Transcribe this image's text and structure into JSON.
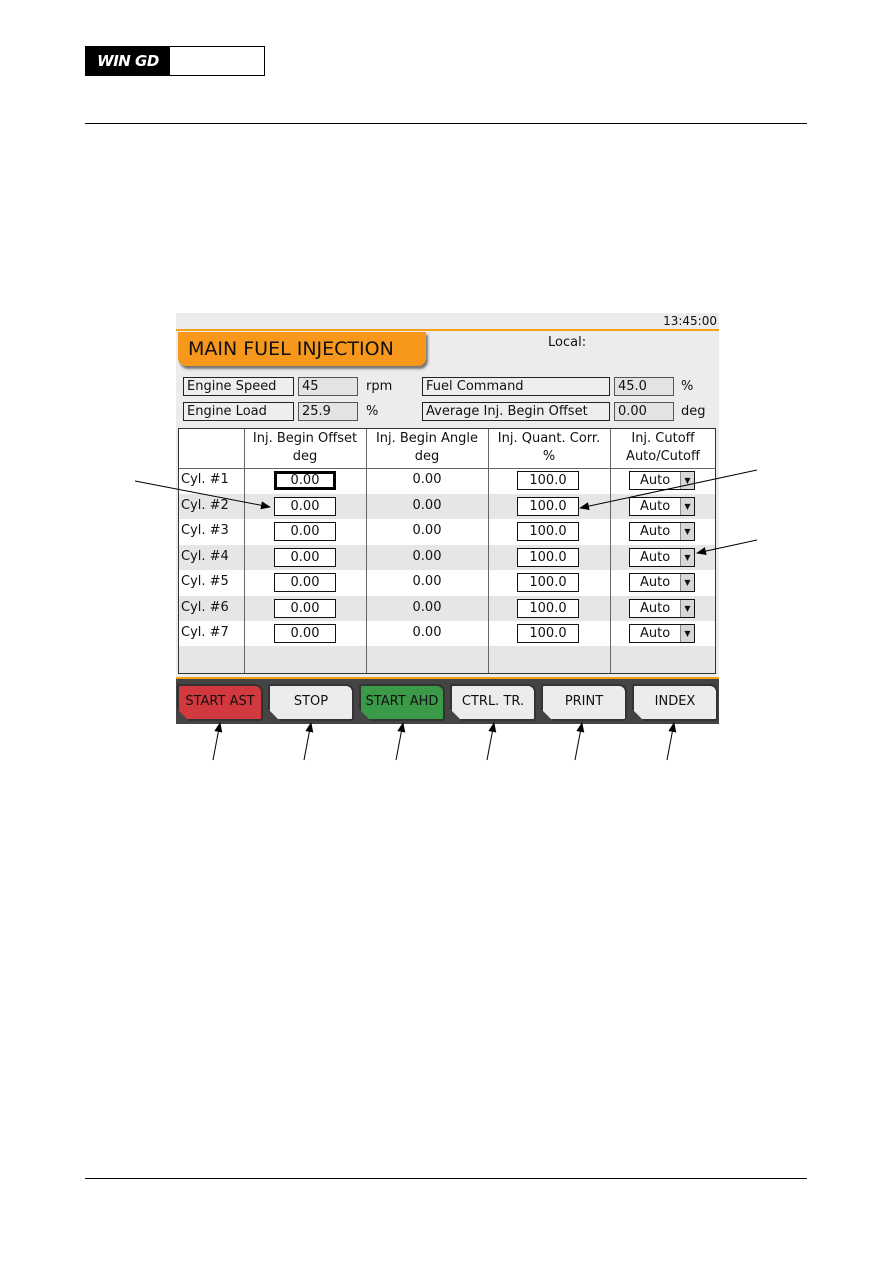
{
  "header": {
    "logo_text": "WIN GD"
  },
  "screen": {
    "clock": "13:45:00",
    "title": "MAIN FUEL INJECTION",
    "local_label": "Local:",
    "readouts": [
      {
        "label": "Engine Speed",
        "value": "45",
        "unit": "rpm"
      },
      {
        "label": "Engine Load",
        "value": "25.9",
        "unit": "%"
      },
      {
        "label": "Fuel Command",
        "value": "45.0",
        "unit": "%"
      },
      {
        "label": "Average Inj. Begin Offset",
        "value": "0.00",
        "unit": "deg"
      }
    ],
    "table": {
      "headers": [
        {
          "line1": "Inj. Begin Offset",
          "line2": "deg"
        },
        {
          "line1": "Inj. Begin Angle",
          "line2": "deg"
        },
        {
          "line1": "Inj. Quant. Corr.",
          "line2": "%"
        },
        {
          "line1": "Inj. Cutoff",
          "line2": "Auto/Cutoff"
        }
      ],
      "rows": [
        {
          "cyl": "Cyl. #1",
          "offset": "0.00",
          "angle": "0.00",
          "quant": "100.0",
          "cutoff": "Auto"
        },
        {
          "cyl": "Cyl. #2",
          "offset": "0.00",
          "angle": "0.00",
          "quant": "100.0",
          "cutoff": "Auto"
        },
        {
          "cyl": "Cyl. #3",
          "offset": "0.00",
          "angle": "0.00",
          "quant": "100.0",
          "cutoff": "Auto"
        },
        {
          "cyl": "Cyl. #4",
          "offset": "0.00",
          "angle": "0.00",
          "quant": "100.0",
          "cutoff": "Auto"
        },
        {
          "cyl": "Cyl. #5",
          "offset": "0.00",
          "angle": "0.00",
          "quant": "100.0",
          "cutoff": "Auto"
        },
        {
          "cyl": "Cyl. #6",
          "offset": "0.00",
          "angle": "0.00",
          "quant": "100.0",
          "cutoff": "Auto"
        },
        {
          "cyl": "Cyl. #7",
          "offset": "0.00",
          "angle": "0.00",
          "quant": "100.0",
          "cutoff": "Auto"
        }
      ]
    },
    "buttons": [
      {
        "label": "START AST",
        "color": "#d2393f"
      },
      {
        "label": "STOP"
      },
      {
        "label": "START AHD",
        "color": "#3a9a48"
      },
      {
        "label": "CTRL. TR."
      },
      {
        "label": "PRINT"
      },
      {
        "label": "INDEX"
      }
    ],
    "accent": "#f7981d"
  }
}
